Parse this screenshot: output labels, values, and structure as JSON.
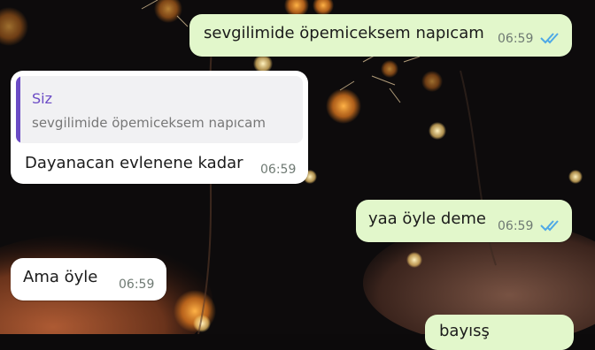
{
  "messages": [
    {
      "text": "sevgilimide öpemiceksem napıcam",
      "time": "06:59",
      "status": "read"
    },
    {
      "reply_to": {
        "name": "Siz",
        "text": "sevgilimide öpemiceksem napıcam"
      },
      "text": "Dayanacan evlenene kadar",
      "time": "06:59"
    },
    {
      "text": "yaa öyle deme",
      "time": "06:59",
      "status": "read"
    },
    {
      "text": "Ama öyle",
      "time": "06:59"
    },
    {
      "text": "bayısş"
    }
  ],
  "colors": {
    "outgoing_bubble": "#e2f7cb",
    "incoming_bubble": "#ffffff",
    "read_ticks": "#4fa9e6",
    "reply_accent": "#6b4bc5"
  }
}
